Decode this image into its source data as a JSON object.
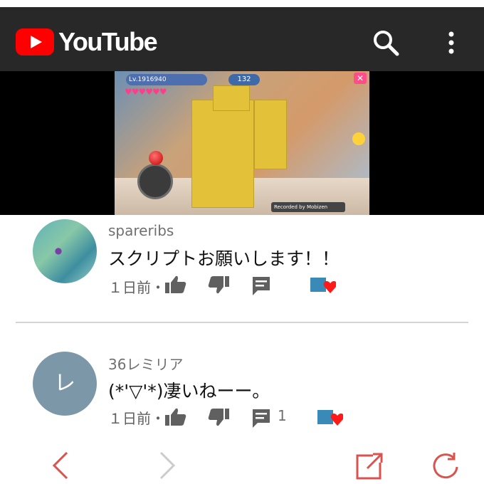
{
  "header": {
    "logo_text": "YouTube",
    "brand_color": "#ff0000",
    "icons": [
      "search-icon",
      "more-vert-icon"
    ]
  },
  "video": {
    "hud_level": "Lv.1916940",
    "hud_counter": "132",
    "watermark": "Recorded by Mobizen"
  },
  "comments": [
    {
      "author": "spareribs",
      "text": "スクリプトお願いします！！",
      "time": "１日前・",
      "reply_count": ""
    },
    {
      "author": "36レミリア",
      "avatar_letter": "レ",
      "text": "(*'▽'*)凄いねーー。",
      "time": "１日前・",
      "reply_count": "1"
    }
  ],
  "browser_nav": {
    "icons": [
      "back-icon",
      "forward-icon",
      "share-icon",
      "reload-icon"
    ],
    "color": "#d9534f"
  }
}
